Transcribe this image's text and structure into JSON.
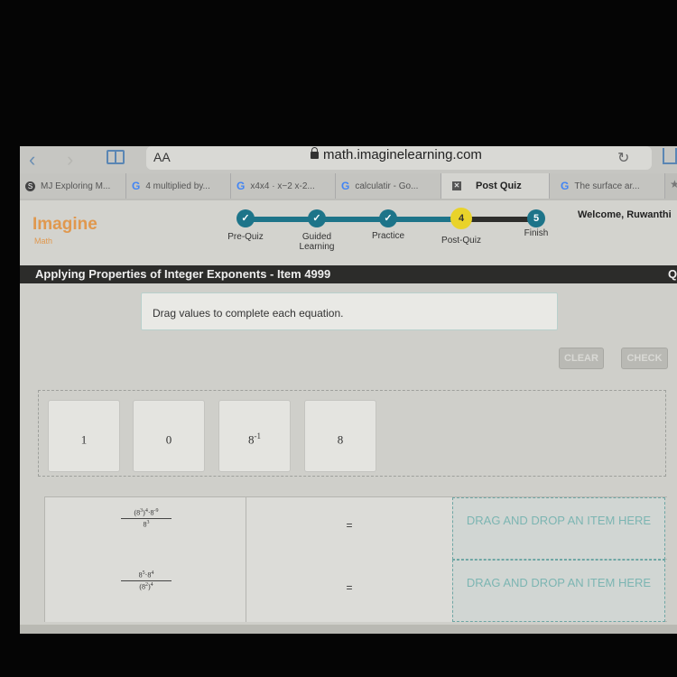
{
  "browser": {
    "text_size_label": "AA",
    "url": "math.imaginelearning.com",
    "tabs": [
      {
        "label": "MJ Exploring M...",
        "icon": "s-icon",
        "active": false
      },
      {
        "label": "4 multiplied by...",
        "icon": "google-icon",
        "active": false
      },
      {
        "label": "x4x4 · x−2 x-2...",
        "icon": "google-icon",
        "active": false
      },
      {
        "label": "calculatir - Go...",
        "icon": "google-icon",
        "active": false
      },
      {
        "label": "Post Quiz",
        "icon": "close-icon",
        "active": true
      },
      {
        "label": "The surface ar...",
        "icon": "google-icon",
        "active": false
      }
    ]
  },
  "header": {
    "logo": "Imagine",
    "logo_sub": "Math",
    "welcome": "Welcome, Ruwanthi",
    "steps": [
      {
        "label": "Pre-Quiz",
        "status": "complete",
        "marker": "✓"
      },
      {
        "label": "Guided Learning",
        "status": "complete",
        "marker": "✓"
      },
      {
        "label": "Practice",
        "status": "complete",
        "marker": "✓"
      },
      {
        "label": "Post-Quiz",
        "status": "current",
        "marker": "4"
      },
      {
        "label": "Finish",
        "status": "upcoming",
        "marker": "5"
      }
    ],
    "colors": {
      "complete": "#1d7489",
      "current": "#e9d32a",
      "logo": "#e0984e"
    }
  },
  "title_bar": {
    "title": "Applying Properties of Integer Exponents - Item 4999",
    "right_glyph": "Q"
  },
  "instruction": "Drag values to complete each equation.",
  "buttons": {
    "clear": "CLEAR",
    "check": "CHECK"
  },
  "tiles": [
    {
      "base": "1",
      "exp": ""
    },
    {
      "base": "0",
      "exp": ""
    },
    {
      "base": "8",
      "exp": "-1"
    },
    {
      "base": "8",
      "exp": ""
    }
  ],
  "equations": [
    {
      "numerator": {
        "p1": "(8",
        "e1": "3",
        "p2": ")",
        "e2": "4",
        "p3": "·8",
        "e3": "-9"
      },
      "denominator": {
        "p1": "8",
        "e1": "3",
        "p2": "",
        "e2": ""
      },
      "equals": "=",
      "drop_label": "DRAG AND DROP AN ITEM HERE"
    },
    {
      "numerator": {
        "p1": "8",
        "e1": "5",
        "p2": "·8",
        "e2": "4",
        "p3": "",
        "e3": ""
      },
      "denominator": {
        "p1": "(8",
        "e1": "2",
        "p2": ")",
        "e2": "4"
      },
      "equals": "=",
      "drop_label": "DRAG AND DROP AN ITEM HERE"
    }
  ]
}
